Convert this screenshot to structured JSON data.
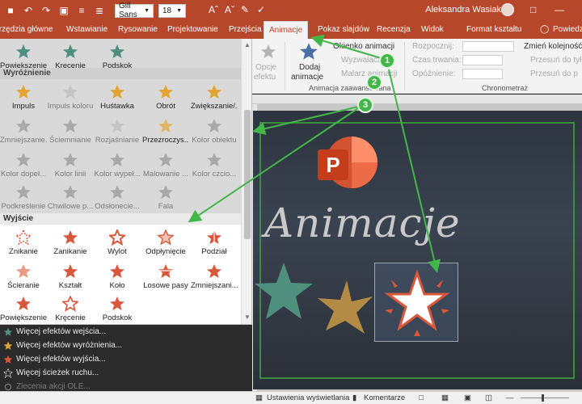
{
  "titlebar": {
    "font_name": "Gill Sans",
    "font_size": "18",
    "user": "Aleksandra Wasiak"
  },
  "tabs": [
    {
      "label": "Narzędzia główne",
      "active": false
    },
    {
      "label": "Wstawianie",
      "active": false
    },
    {
      "label": "Rysowanie",
      "active": false
    },
    {
      "label": "Projektowanie",
      "active": false
    },
    {
      "label": "Przejścia",
      "active": false
    },
    {
      "label": "Animacje",
      "active": true
    },
    {
      "label": "Pokaz slajdów",
      "active": false
    },
    {
      "label": "Recenzja",
      "active": false
    },
    {
      "label": "Widok",
      "active": false
    },
    {
      "label": "Format kształtu",
      "active": false
    },
    {
      "label": "Powiedz",
      "active": false
    }
  ],
  "ribbon": {
    "opcje_line1": "Opcje",
    "opcje_line2": "efektu",
    "dodaj_line1": "Dodaj",
    "dodaj_line2": "animacje",
    "okienko": "Okienko animacji",
    "wyzwalacz": "Wyzwalacz",
    "malarz": "Malarz animacji",
    "group_zaawansowana": "Animacja zaawansowana",
    "rozpocznij": "Rozpocznij:",
    "czas_trwania": "Czas trwania:",
    "opoznienie": "Opóźnienie:",
    "zmien_kolejnosc": "Zmień kolejność a",
    "przesun_wczesniej": "Przesuń do tył",
    "przesun_pozniej": "Przesuń do p",
    "group_chronometraz": "Chronometraż"
  },
  "slide": {
    "title": "Animacje",
    "logo_letter": "P"
  },
  "gallery": {
    "top_row": [
      {
        "label": "Powiększenie",
        "icon": "star-icon",
        "color": "#4e8f7e"
      },
      {
        "label": "Kręcenie",
        "icon": "star-icon",
        "color": "#4e8f7e"
      },
      {
        "label": "Podskok",
        "icon": "star-icon",
        "color": "#4e8f7e"
      }
    ],
    "emphasis_header": "Wyróżnienie",
    "emphasis": [
      {
        "label": "Impuls",
        "dim": false,
        "color": "#e2a533"
      },
      {
        "label": "Impuls koloru",
        "dim": true,
        "color": "#bdbdbd"
      },
      {
        "label": "Huśtawka",
        "dim": false,
        "color": "#e2a533"
      },
      {
        "label": "Obrót",
        "dim": false,
        "color": "#e2a533"
      },
      {
        "label": "Zwiększanie/...",
        "dim": false,
        "color": "#e2a533"
      },
      {
        "label": "Zmniejszanie...",
        "dim": true,
        "color": "#a9a9a9"
      },
      {
        "label": "Ściemnianie",
        "dim": true,
        "color": "#a9a9a9"
      },
      {
        "label": "Rozjaśnianie",
        "dim": true,
        "color": "#bdbdbd"
      },
      {
        "label": "Przezroczys...",
        "dim": false,
        "color": "#e2a533"
      },
      {
        "label": "Kolor obiektu",
        "dim": true,
        "color": "#a9a9a9"
      },
      {
        "label": "Kolor dopeł...",
        "dim": true,
        "color": "#a9a9a9"
      },
      {
        "label": "Kolor linii",
        "dim": true,
        "color": "#a9a9a9"
      },
      {
        "label": "Kolor wypeł...",
        "dim": true,
        "color": "#a9a9a9"
      },
      {
        "label": "Malowanie ...",
        "dim": true,
        "color": "#a9a9a9"
      },
      {
        "label": "Kolor czcio...",
        "dim": true,
        "color": "#a9a9a9"
      },
      {
        "label": "Podkreślenie",
        "dim": true,
        "color": "#a9a9a9"
      },
      {
        "label": "Chwilowe p...",
        "dim": true,
        "color": "#a9a9a9"
      },
      {
        "label": "Odsłonecie...",
        "dim": true,
        "color": "#a9a9a9"
      },
      {
        "label": "Fala",
        "dim": true,
        "color": "#a9a9a9"
      }
    ],
    "exit_header": "Wyjście",
    "exit": [
      {
        "label": "Znikanie",
        "color": "#d9573a"
      },
      {
        "label": "Zanikanie",
        "color": "#d9573a"
      },
      {
        "label": "Wylot",
        "color": "#d9573a"
      },
      {
        "label": "Odpłynięcie",
        "color": "#d9573a"
      },
      {
        "label": "Podział",
        "color": "#d9573a"
      },
      {
        "label": "Ścieranie",
        "color": "#d9573a"
      },
      {
        "label": "Kształt",
        "color": "#d9573a"
      },
      {
        "label": "Koło",
        "color": "#d9573a"
      },
      {
        "label": "Losowe pasy",
        "color": "#d9573a"
      },
      {
        "label": "Zmniejszani...",
        "color": "#d9573a"
      },
      {
        "label": "Powiększenie",
        "color": "#d9573a"
      },
      {
        "label": "Kręcenie",
        "color": "#d9573a"
      },
      {
        "label": "Podskok",
        "color": "#d9573a"
      }
    ]
  },
  "effects_menu": [
    {
      "label": "Więcej efektów wejścia...",
      "color": "#4e8f7e",
      "dim": false
    },
    {
      "label": "Więcej efektów wyróżnienia...",
      "color": "#e2a533",
      "dim": false
    },
    {
      "label": "Więcej efektów wyjścia...",
      "color": "#d9573a",
      "dim": false
    },
    {
      "label": "Więcej ścieżek ruchu...",
      "color": "#ffffff",
      "dim": false
    },
    {
      "label": "Zlecenia akcji OLE...",
      "color": "#7c7c7c",
      "dim": true
    }
  ],
  "statusbar": {
    "display_settings": "Ustawienia wyświetlania",
    "comments": "Komentarze"
  },
  "callouts": [
    "1",
    "2",
    "3"
  ],
  "colors": {
    "accent": "#b7472a",
    "callout": "#43b649",
    "entrance": "#4e8f7e",
    "emphasis": "#e2a533",
    "exit": "#d9573a"
  }
}
